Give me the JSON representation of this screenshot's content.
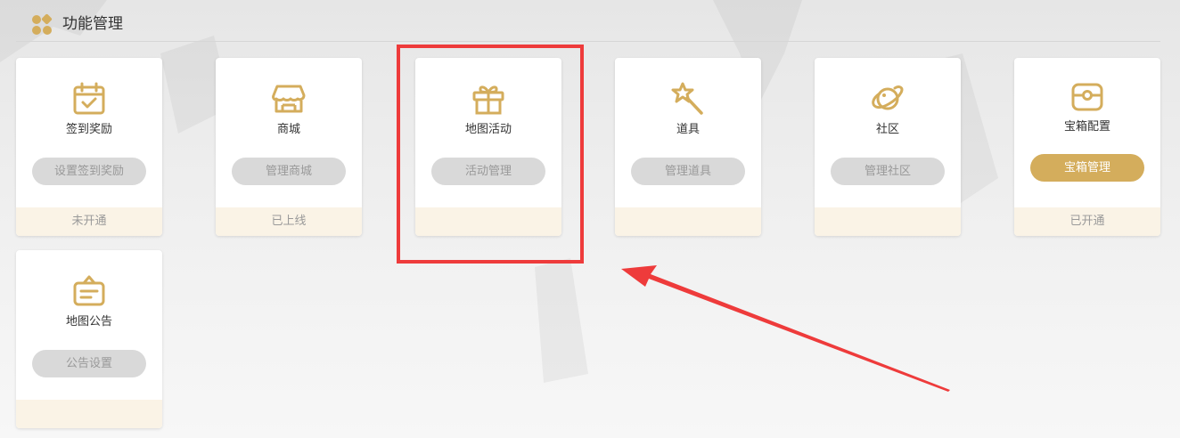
{
  "header": {
    "title": "功能管理",
    "icon": "grid-icon"
  },
  "colors": {
    "accent": "#d4ad5c",
    "button_disabled_bg": "#d9d9d9",
    "footer_bg": "#faf3e6",
    "highlight": "#ee3b3b"
  },
  "cards": [
    {
      "icon": "calendar-check-icon",
      "title": "签到奖励",
      "button": "设置签到奖励",
      "status": "未开通"
    },
    {
      "icon": "store-icon",
      "title": "商城",
      "button": "管理商城",
      "status": "已上线"
    },
    {
      "icon": "gift-icon",
      "title": "地图活动",
      "button": "活动管理",
      "status": ""
    },
    {
      "icon": "magic-wand-icon",
      "title": "道具",
      "button": "管理道具",
      "status": ""
    },
    {
      "icon": "planet-icon",
      "title": "社区",
      "button": "管理社区",
      "status": ""
    },
    {
      "icon": "treasure-chest-icon",
      "title": "宝箱配置",
      "button": "宝箱管理",
      "status": "已开通"
    },
    {
      "icon": "notice-board-icon",
      "title": "地图公告",
      "button": "公告设置",
      "status": ""
    }
  ]
}
